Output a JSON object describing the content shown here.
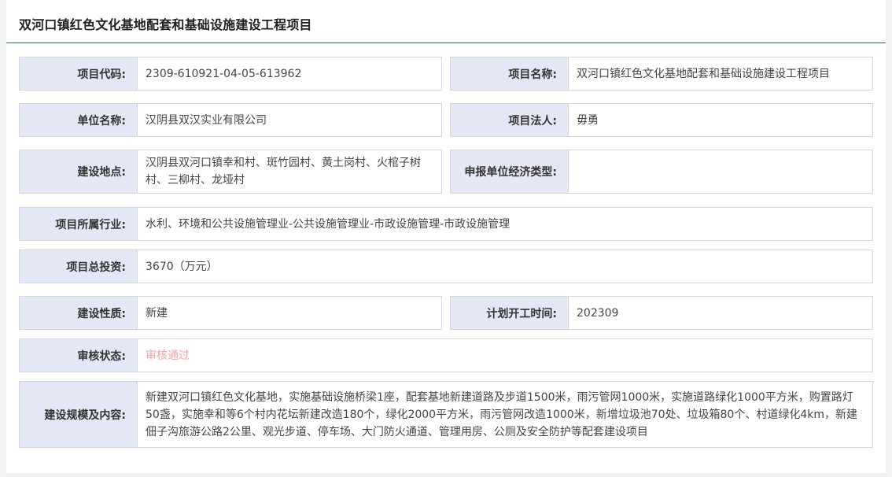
{
  "title": "双河口镇红色文化基地配套和基础设施建设工程项目",
  "fields": {
    "project_code": {
      "label": "项目代码:",
      "value": "2309-610921-04-05-613962"
    },
    "project_name": {
      "label": "项目名称:",
      "value": "双河口镇红色文化基地配套和基础设施建设工程项目"
    },
    "unit_name": {
      "label": "单位名称:",
      "value": "汉阴县双汉实业有限公司"
    },
    "legal_person": {
      "label": "项目法人:",
      "value": "毋勇"
    },
    "location": {
      "label": "建设地点:",
      "value": "汉阴县双河口镇幸和村、斑竹园村、黄土岗村、火棺子树村、三柳村、龙垭村"
    },
    "economic_type": {
      "label": "申报单位经济类型:",
      "value": ""
    },
    "industry": {
      "label": "项目所属行业:",
      "value": "水利、环境和公共设施管理业-公共设施管理业-市政设施管理-市政设施管理"
    },
    "total_investment": {
      "label": "项目总投资:",
      "value": "3670（万元）"
    },
    "nature": {
      "label": "建设性质:",
      "value": "新建"
    },
    "start_time": {
      "label": "计划开工时间:",
      "value": "202309"
    },
    "review_status": {
      "label": "审核状态:",
      "value": "审核通过"
    },
    "scale": {
      "label": "建设规模及内容:",
      "value": "新建双河口镇红色文化基地，实施基础设施桥梁1座，配套基地新建道路及步道1500米，雨污管网1000米，实施道路绿化1000平方米，购置路灯50盏，实施幸和等6个村内花坛新建改造180个，绿化2000平方米，雨污管网改造1000米，新增垃圾池70处、垃圾箱80个、村道绿化4km，新建佃子沟旅游公路2公里、观光步道、停车场、大门防火通道、管理用房、公厕及安全防护等配套建设项目"
    }
  },
  "colors": {
    "label_bg": "#e4e8f6",
    "border": "#d6d6d6",
    "title_rule": "#1f6e7a",
    "status_pass": "#f3a2a2"
  }
}
